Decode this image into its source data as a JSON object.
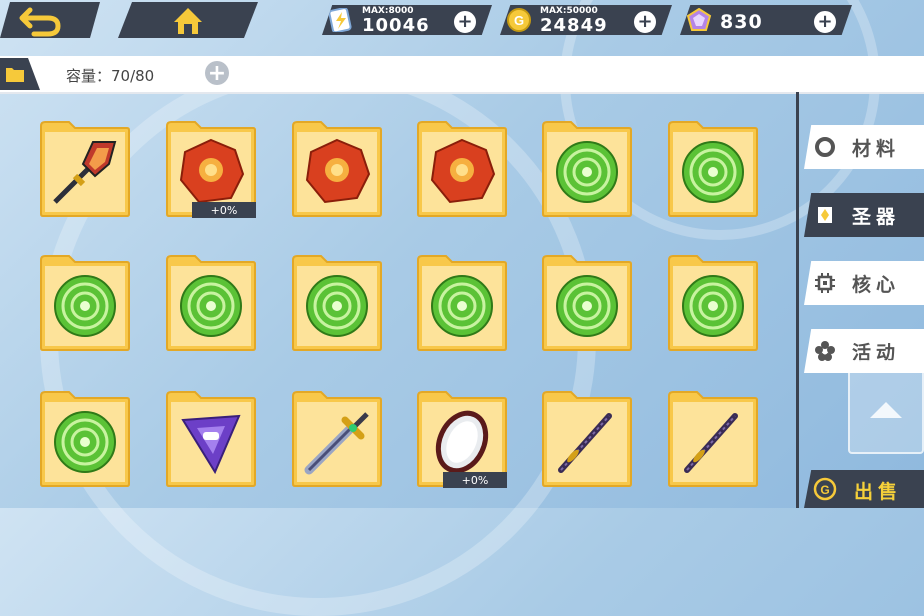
{
  "resources": {
    "energy": {
      "max_label": "MAX:",
      "max_value": "8000",
      "value": "10046"
    },
    "coins": {
      "max_label": "MAX:",
      "max_value": "50000",
      "value": "24849"
    },
    "gems": {
      "value": "830"
    }
  },
  "capacity": {
    "label": "容量：70/80"
  },
  "tabs": [
    {
      "label": "材料",
      "icon": "gear-ring-icon",
      "active": false
    },
    {
      "label": "圣器",
      "icon": "relic-icon",
      "active": true
    },
    {
      "label": "核心",
      "icon": "chip-icon",
      "active": false
    },
    {
      "label": "活动",
      "icon": "flower-icon",
      "active": false
    }
  ],
  "sell": {
    "label": "出售"
  },
  "items": [
    {
      "type": "spear",
      "badge": ""
    },
    {
      "type": "red-gem",
      "badge": "+0%"
    },
    {
      "type": "red-gem",
      "badge": ""
    },
    {
      "type": "red-gem",
      "badge": ""
    },
    {
      "type": "green-orb",
      "badge": ""
    },
    {
      "type": "green-orb",
      "badge": ""
    },
    {
      "type": "green-orb",
      "badge": ""
    },
    {
      "type": "green-orb",
      "badge": ""
    },
    {
      "type": "green-orb",
      "badge": ""
    },
    {
      "type": "green-orb",
      "badge": ""
    },
    {
      "type": "green-orb",
      "badge": ""
    },
    {
      "type": "green-orb",
      "badge": ""
    },
    {
      "type": "green-orb",
      "badge": ""
    },
    {
      "type": "purple-gem",
      "badge": ""
    },
    {
      "type": "sword",
      "badge": ""
    },
    {
      "type": "mirror-shield",
      "badge": "+0%"
    },
    {
      "type": "katana",
      "badge": ""
    },
    {
      "type": "katana",
      "badge": ""
    }
  ]
}
